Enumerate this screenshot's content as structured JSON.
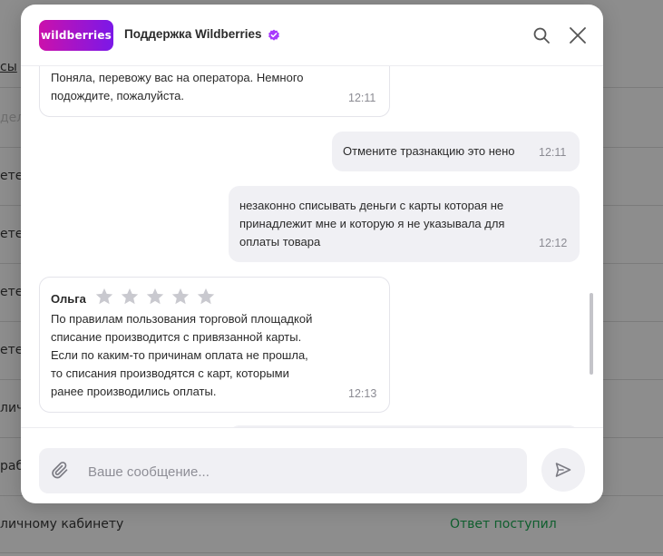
{
  "background": {
    "rows": [
      "сы",
      "деле",
      "етен",
      "етен",
      "етен",
      "етен",
      "личн",
      "раб",
      "личному кабинету"
    ],
    "status": "Ответ поступил"
  },
  "header": {
    "logo": "wildberries",
    "title": "Поддержка Wildberries"
  },
  "messages": [
    {
      "direction": "in",
      "text_lines": [
        "Поняла, перевожу вас на оператора. Немного",
        "подождите, пожалуйста."
      ],
      "time": "12:11"
    },
    {
      "direction": "out",
      "text_lines": [
        "Отмените тразнакцию это нено"
      ],
      "time": "12:11"
    },
    {
      "direction": "out",
      "text_lines": [
        "незаконно списывать деньги с карты которая не",
        "принадлежит мне и которую я не указывала для",
        "оплаты товара"
      ],
      "time": "12:12"
    },
    {
      "direction": "in",
      "sender": "Ольга",
      "rating_stars": 5,
      "text_lines": [
        "По правилам пользования торговой площадкой",
        "списание производится с привязанной карты.",
        "Если по каким-то причинам оплата не прошла,",
        "то списания производятся с карт, которыми",
        "ранее производились оплаты."
      ],
      "time": "12:13"
    }
  ],
  "composer": {
    "placeholder": "Ваше сообщение..."
  },
  "colors": {
    "brand_gradient_start": "#cb11ab",
    "brand_gradient_end": "#7b18e8",
    "verified": "#a73afd",
    "status_green": "#0f5f2e"
  }
}
